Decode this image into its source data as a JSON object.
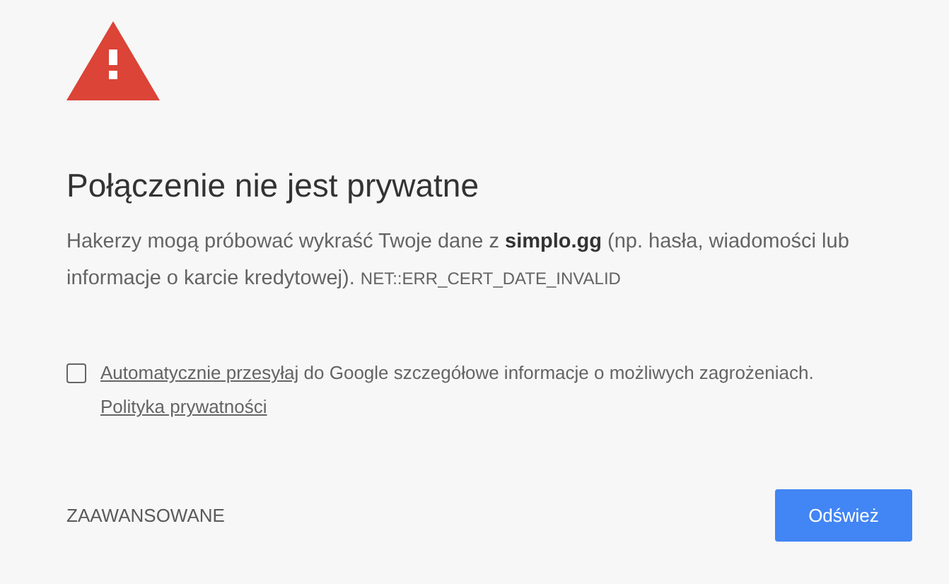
{
  "heading": "Połączenie nie jest prywatne",
  "description": "Hakerzy mogą próbować wykraść Twoje dane z **simplo.gg** (np. hasła, wiadomości lub informacje o karcie kredytowej).",
  "error_code": "NET::ERR_CERT_DATE_INVALID",
  "report": {
    "checked": false,
    "link": "Automatycznie przesyłaj",
    "text": " do Google szczegółowe informacje o możliwych zagrożeniach. ",
    "policy_link": "Polityka prywatności"
  },
  "buttons": {
    "advanced": "ZAAWANSOWANE",
    "reload": "Odśwież"
  }
}
